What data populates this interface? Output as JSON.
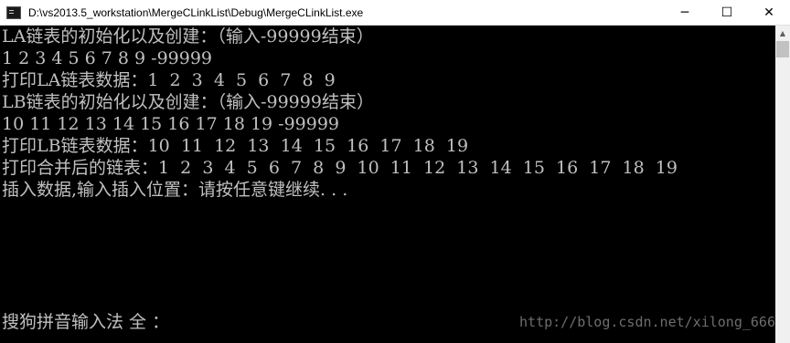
{
  "window": {
    "title": "D:\\vs2013.5_workstation\\MergeCLinkList\\Debug\\MergeCLinkList.exe",
    "minimize_glyph": "─",
    "maximize_glyph": "☐",
    "close_glyph": "✕"
  },
  "console": {
    "lines": [
      "LA链表的初始化以及创建：（输入-99999结束）",
      "1 2 3 4 5 6 7 8 9 -99999",
      "打印LA链表数据：1  2  3  4  5  6  7  8  9",
      "LB链表的初始化以及创建：（输入-99999结束）",
      "10 11 12 13 14 15 16 17 18 19 -99999",
      "打印LB链表数据：10  11  12  13  14  15  16  17  18  19",
      "打印合并后的链表：1  2  3  4  5  6  7  8  9  10  11  12  13  14  15  16  17  18  19",
      "插入数据,输入插入位置：请按任意键继续. . ."
    ],
    "ime_status": "搜狗拼音输入法 全 ：",
    "watermark": "http://blog.csdn.net/xilong_666"
  },
  "scrollbar": {
    "up_glyph": "▲"
  }
}
